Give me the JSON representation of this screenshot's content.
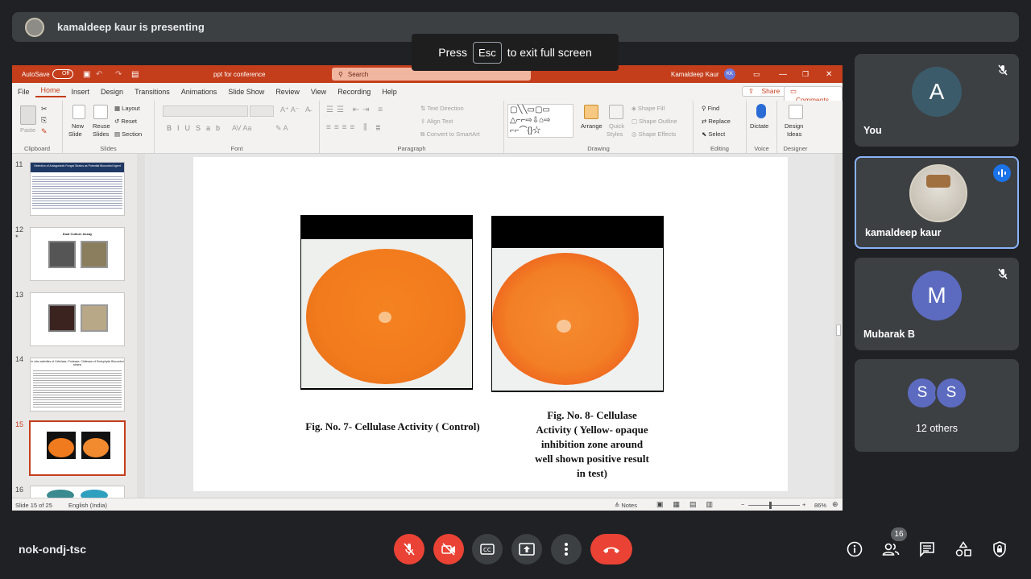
{
  "presenting_bar": {
    "text": "kamaldeep kaur is presenting"
  },
  "esc_notice": {
    "press": "Press",
    "key": "Esc",
    "rest": "to exit full screen"
  },
  "ppt": {
    "autosave": "AutoSave",
    "autosave_state": "Off",
    "doc_title": "ppt for conference",
    "search_placeholder": "Search",
    "user": "Kamaldeep Kaur",
    "user_initials": "KK",
    "menu": [
      "File",
      "Home",
      "Insert",
      "Design",
      "Transitions",
      "Animations",
      "Slide Show",
      "Review",
      "View",
      "Recording",
      "Help"
    ],
    "share": "Share",
    "comments": "Comments",
    "ribbon": {
      "clipboard": {
        "label": "Clipboard",
        "paste": "Paste"
      },
      "slides": {
        "label": "Slides",
        "new_slide": "New",
        "new_slide2": "Slide",
        "reuse": "Reuse",
        "reuse2": "Slides",
        "layout": "Layout",
        "reset": "Reset",
        "section": "Section"
      },
      "font": {
        "label": "Font"
      },
      "paragraph": {
        "label": "Paragraph",
        "text_direction": "Text Direction",
        "align_text": "Align Text",
        "convert": "Convert to SmartArt"
      },
      "drawing": {
        "label": "Drawing",
        "arrange": "Arrange",
        "quick_styles": "Quick",
        "quick_styles2": "Styles",
        "shape_fill": "Shape Fill",
        "shape_outline": "Shape Outline",
        "shape_effects": "Shape Effects"
      },
      "editing": {
        "label": "Editing",
        "find": "Find",
        "replace": "Replace",
        "select": "Select"
      },
      "voice": {
        "label": "Voice",
        "dictate": "Dictate"
      },
      "designer": {
        "label": "Designer",
        "design_ideas": "Design",
        "design_ideas2": "Ideas"
      }
    },
    "thumbnails": [
      {
        "num": "11",
        "title": "Selection of Antagonistic Fungal Strains as Potential Biocontrol Agent"
      },
      {
        "num": "12",
        "title": "Dual Culture Assay"
      },
      {
        "num": "13",
        "title": ""
      },
      {
        "num": "14",
        "title": "In vitro activities of Cellulase, Protease, Chitinase of Endophytic Biocontrol strains"
      },
      {
        "num": "15",
        "title": ""
      },
      {
        "num": "16",
        "title": ""
      }
    ],
    "slide": {
      "caption_left": "Fig. No. 7- Cellulase Activity ( Control)",
      "caption_right_lines": [
        "Fig. No. 8- Cellulase",
        "Activity ( Yellow- opaque",
        "inhibition zone around",
        "well shown positive result",
        "in test)"
      ]
    },
    "status": {
      "slide_of": "Slide 15 of 25",
      "language": "English (India)",
      "notes": "Notes",
      "zoom": "86%"
    }
  },
  "participants": [
    {
      "name": "You",
      "initial": "A",
      "color": "#3b5b6b",
      "muted": true
    },
    {
      "name": "kamaldeep kaur",
      "speaking": true
    },
    {
      "name": "Mubarak B",
      "initial": "M",
      "color": "#5c6bc0",
      "muted": true
    },
    {
      "name": "12 others",
      "initials": [
        "S",
        "S"
      ],
      "color": "#5c6bc0"
    }
  ],
  "bottom": {
    "meeting_code": "nok-ondj-tsc",
    "people_count": "16"
  },
  "colors": {
    "accent": "#c43e1c",
    "meet_red": "#ea4335",
    "speaking_border": "#8ab4f8",
    "agar": "#f07a1e"
  }
}
